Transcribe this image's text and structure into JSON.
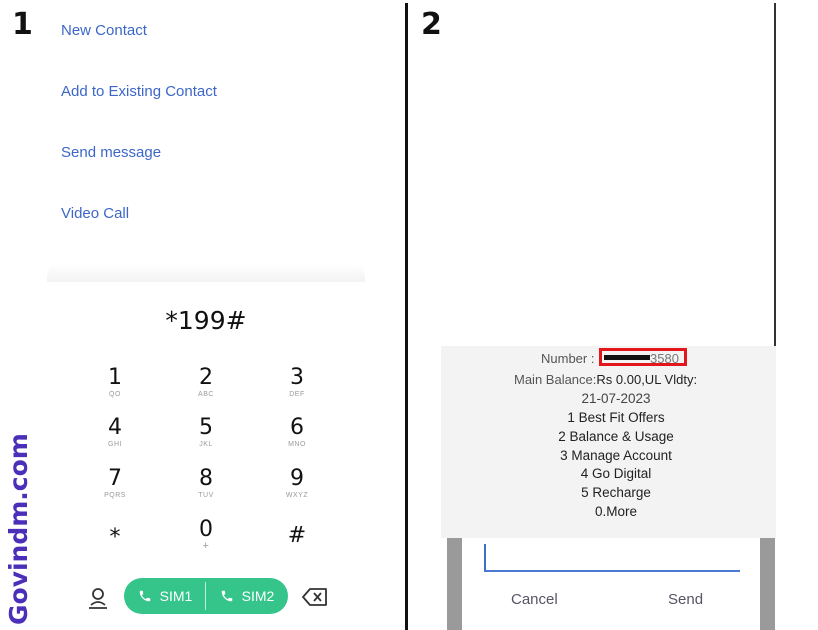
{
  "steps": {
    "first": "1",
    "second": "2"
  },
  "watermark": "Govindm.com",
  "contact_menu": {
    "items": [
      {
        "label": "New Contact"
      },
      {
        "label": "Add to Existing Contact"
      },
      {
        "label": "Send message"
      },
      {
        "label": "Video Call"
      }
    ]
  },
  "dialer": {
    "number": "*199#",
    "keys": [
      {
        "digit": "1",
        "letters": "QO"
      },
      {
        "digit": "2",
        "letters": "ABC"
      },
      {
        "digit": "3",
        "letters": "DEF"
      },
      {
        "digit": "4",
        "letters": "GHI"
      },
      {
        "digit": "5",
        "letters": "JKL"
      },
      {
        "digit": "6",
        "letters": "MNO"
      },
      {
        "digit": "7",
        "letters": "PQRS"
      },
      {
        "digit": "8",
        "letters": "TUV"
      },
      {
        "digit": "9",
        "letters": "WXYZ"
      },
      {
        "digit": "*",
        "letters": ""
      },
      {
        "digit": "0",
        "letters": "+"
      },
      {
        "digit": "#",
        "letters": ""
      }
    ],
    "sim1_label": "SIM1",
    "sim2_label": "SIM2",
    "accent": "#35c48a",
    "link_color": "#3c67c8"
  },
  "ussd": {
    "number_label": "Number :",
    "number_tail": "3580",
    "balance_label": "Main Balance:",
    "balance_value": "Rs 0.00,UL Vldty:",
    "validity_date": "21-07-2023",
    "menu": [
      "1 Best Fit Offers",
      "2 Balance & Usage",
      "3 Manage Account",
      "4 Go Digital",
      "5 Recharge",
      "0.More"
    ],
    "input_value": "",
    "cancel_label": "Cancel",
    "send_label": "Send",
    "highlight_color": "#e3161c"
  }
}
